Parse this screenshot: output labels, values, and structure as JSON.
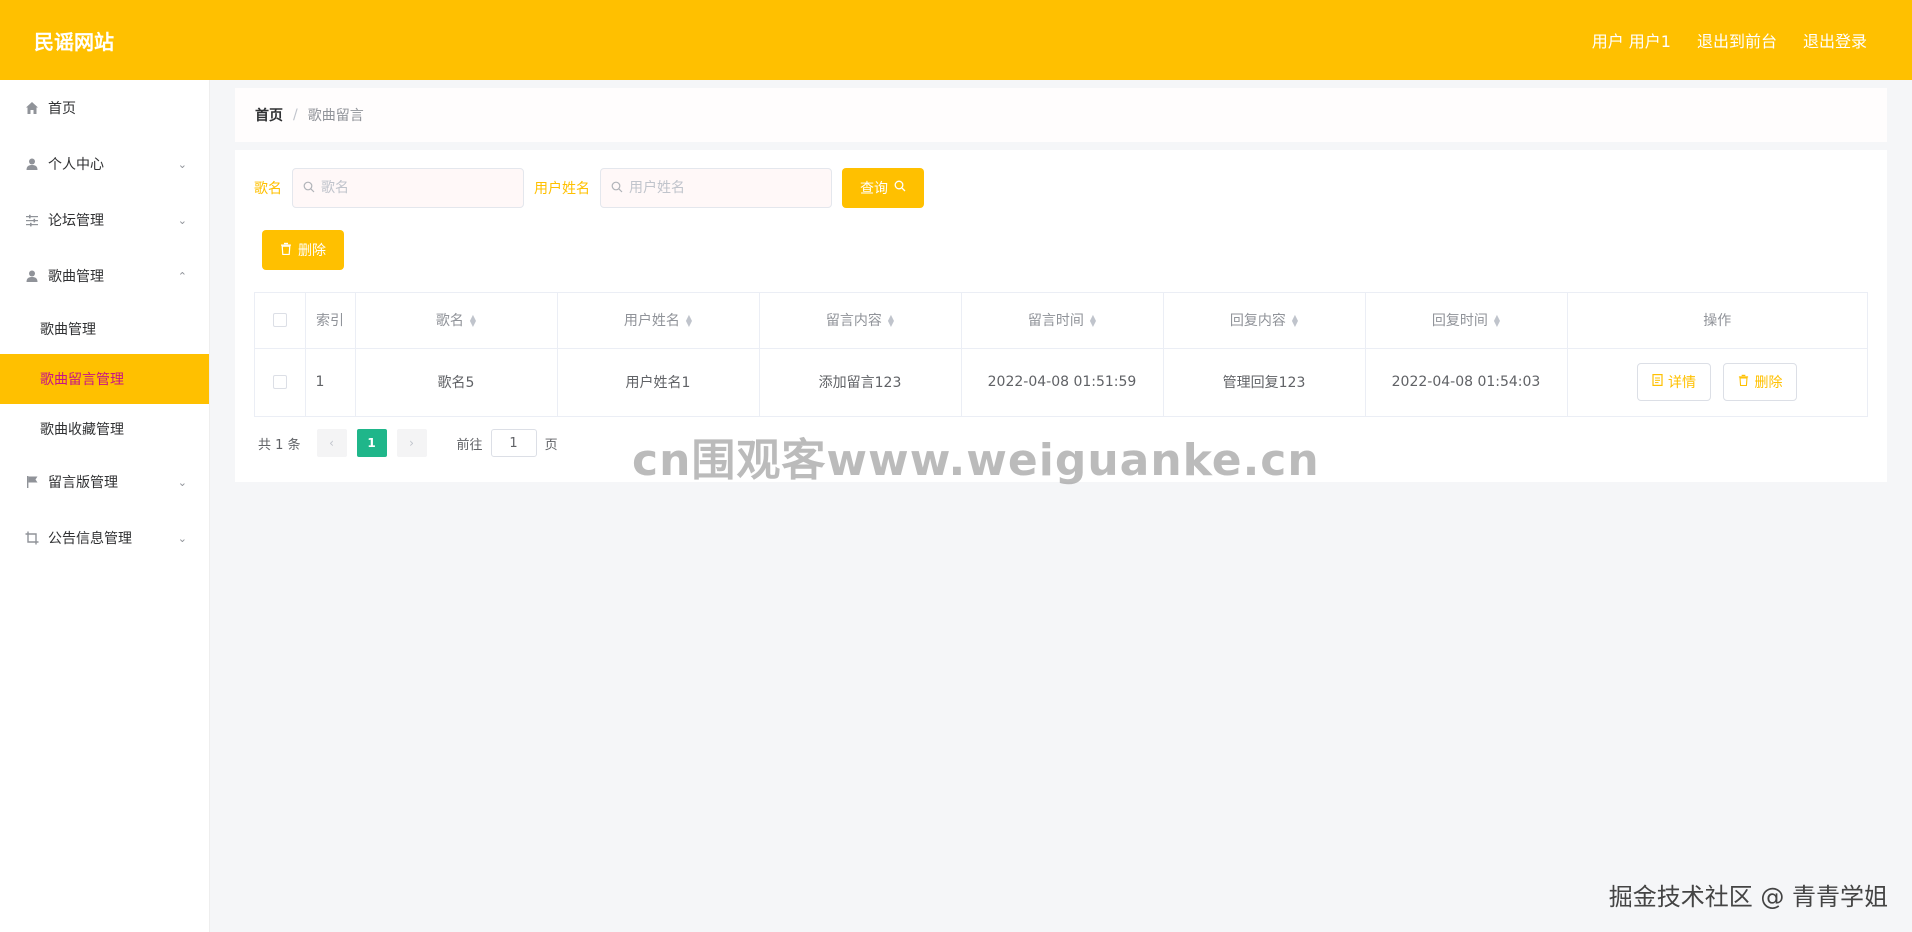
{
  "header": {
    "brand": "民谣网站",
    "user_label": "用户 用户1",
    "to_front": "退出到前台",
    "logout": "退出登录"
  },
  "sidebar": {
    "items": [
      {
        "label": "首页",
        "icon": "home-icon"
      },
      {
        "label": "个人中心",
        "icon": "user-icon"
      },
      {
        "label": "论坛管理",
        "icon": "sliders-icon"
      },
      {
        "label": "歌曲管理",
        "icon": "user-icon"
      },
      {
        "label": "留言版管理",
        "icon": "flag-icon"
      },
      {
        "label": "公告信息管理",
        "icon": "crop-icon"
      }
    ],
    "submenu": [
      {
        "label": "歌曲管理"
      },
      {
        "label": "歌曲留言管理"
      },
      {
        "label": "歌曲收藏管理"
      }
    ]
  },
  "breadcrumb": {
    "home": "首页",
    "separator": "/",
    "current": "歌曲留言"
  },
  "search": {
    "song_label": "歌名",
    "song_placeholder": "歌名",
    "user_label": "用户姓名",
    "user_placeholder": "用户姓名",
    "query_button": "查询"
  },
  "actions": {
    "delete_button": "删除"
  },
  "table": {
    "headers": [
      "索引",
      "歌名",
      "用户姓名",
      "留言内容",
      "留言时间",
      "回复内容",
      "回复时间",
      "操作"
    ],
    "rows": [
      {
        "index": "1",
        "song": "歌名5",
        "user": "用户姓名1",
        "content": "添加留言123",
        "time": "2022-04-08 01:51:59",
        "reply": "管理回复123",
        "reply_time": "2022-04-08 01:54:03",
        "detail_button": "详情",
        "delete_button": "删除"
      }
    ]
  },
  "pager": {
    "total": "共 1 条",
    "current_page": "1",
    "goto_prefix": "前往",
    "goto_value": "1",
    "goto_suffix": "页"
  },
  "overlays": {
    "watermark": "cn围观客www.weiguanke.cn",
    "credit": "掘金技术社区 @ 青青学姐"
  },
  "colors": {
    "primary": "#ffc000",
    "active_text": "#c71585",
    "pager_active": "#1fb68a"
  }
}
